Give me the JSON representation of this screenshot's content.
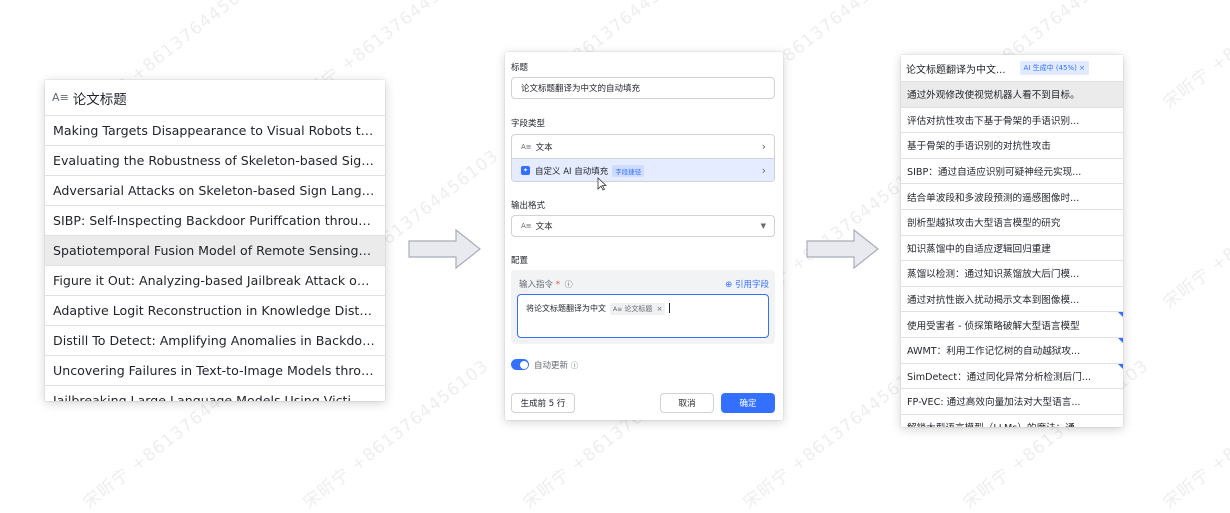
{
  "watermark": "宋昕宁 +8613764456103",
  "source_column": {
    "header": "论文标题",
    "header_icon": "text-field-icon",
    "rows": [
      "Making Targets Disappearance to Visual Robots throu...",
      "Evaluating the Robustness of Skeleton-based Sign La...",
      "Adversarial Attacks on Skeleton-based Sign Language...",
      "SIBP: Self-Inspecting Backdoor Puriffcation through A...",
      "Spatiotemporal Fusion Model of Remote Sensing Ima...",
      "Figure it Out: Analyzing-based Jailbreak Attack on Lar...",
      "Adaptive Logit Reconstruction in Knowledge Distillation",
      "Distill To Detect: Amplifying Anomalies in Backdoor M...",
      "Uncovering Failures in Text-to-Image Models through ...",
      "Jailbreaking Large Language Models Using Victim-Det..."
    ],
    "selected_index": 4
  },
  "dialog": {
    "title_label": "标题",
    "title_value": "论文标题翻译为中文的自动填充",
    "field_type_label": "字段类型",
    "field_type_text": "文本",
    "field_type_ai": "自定义 AI 自动填充",
    "field_type_ai_badge": "字段捷径",
    "output_format_label": "输出格式",
    "output_format_value": "文本",
    "config_label": "配置",
    "prompt_label": "输入指令",
    "required_mark": "*",
    "info_icon": "ⓘ",
    "cite_field": "⊕ 引用字段",
    "prompt_text": "将论文标题翻译为中文",
    "prompt_chip": "论文标题",
    "auto_update_label": "自动更新",
    "preview_button": "生成前 5 行",
    "cancel_button": "取消",
    "confirm_button": "确定",
    "accent": "#3370ff"
  },
  "result_column": {
    "header": "论文标题翻译为中文...",
    "status": "AI 生成中 (45%)",
    "status_close": "×",
    "progress": 0.45,
    "rows": [
      "通过外观修改使视觉机器人看不到目标。",
      "评估对抗性攻击下基于骨架的手语识别...",
      "基于骨架的手语识别的对抗性攻击",
      "SIBP：通过自适应识别可疑神经元实现...",
      "结合单波段和多波段预测的遥感图像时...",
      "剖析型越狱攻击大型语言模型的研究",
      "知识蒸馏中的自适应逻辑回归重建",
      "蒸馏以检测：通过知识蒸馏放大后门模...",
      "通过对抗性嵌入扰动揭示文本到图像模...",
      "使用受害者 - 侦探策略破解大型语言模型",
      "AWMT：利用工作记忆树的自动越狱攻...",
      "SimDetect：通过同化异常分析检测后门...",
      "FP-VEC: 通过高效向量加法对大型语言...",
      "解锁大型语言模型（LLMs）的魔法：通..."
    ],
    "selected_index": 0,
    "marked_rows": [
      9,
      10,
      11
    ]
  }
}
